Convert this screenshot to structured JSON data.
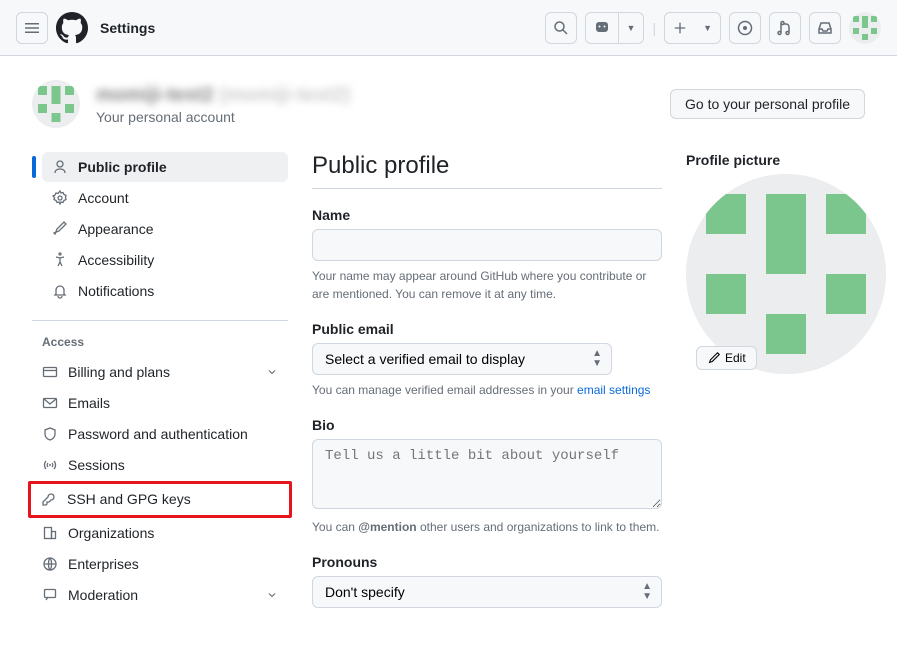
{
  "topbar": {
    "title": "Settings"
  },
  "header": {
    "username": "momiji-test2",
    "username_paren": "(momiji-test2)",
    "subtitle": "Your personal account",
    "profile_btn": "Go to your personal profile"
  },
  "sidebar": {
    "items_top": [
      {
        "label": "Public profile"
      },
      {
        "label": "Account"
      },
      {
        "label": "Appearance"
      },
      {
        "label": "Accessibility"
      },
      {
        "label": "Notifications"
      }
    ],
    "access_heading": "Access",
    "items_access": [
      {
        "label": "Billing and plans"
      },
      {
        "label": "Emails"
      },
      {
        "label": "Password and authentication"
      },
      {
        "label": "Sessions"
      },
      {
        "label": "SSH and GPG keys"
      },
      {
        "label": "Organizations"
      },
      {
        "label": "Enterprises"
      },
      {
        "label": "Moderation"
      }
    ]
  },
  "form": {
    "page_title": "Public profile",
    "name_label": "Name",
    "name_hint": "Your name may appear around GitHub where you contribute or are mentioned. You can remove it at any time.",
    "email_label": "Public email",
    "email_select": "Select a verified email to display",
    "email_hint_pre": "You can manage verified email addresses in your ",
    "email_hint_link": "email settings",
    "bio_label": "Bio",
    "bio_placeholder": "Tell us a little bit about yourself",
    "bio_hint_pre": "You can ",
    "bio_hint_strong": "@mention",
    "bio_hint_post": " other users and organizations to link to them.",
    "pronouns_label": "Pronouns",
    "pronouns_select": "Don't specify"
  },
  "sidecol": {
    "heading": "Profile picture",
    "edit": "Edit"
  }
}
